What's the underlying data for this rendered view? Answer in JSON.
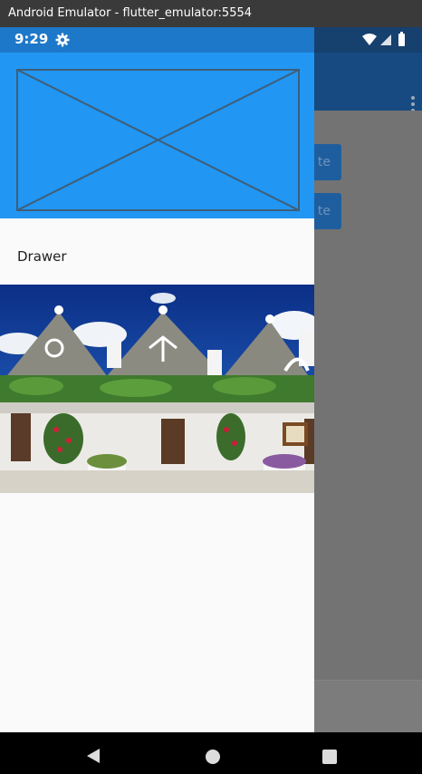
{
  "window": {
    "title": "Android Emulator - flutter_emulator:5554"
  },
  "status_bar": {
    "time": "9:29",
    "settings_icon": "gear-icon",
    "wifi_icon": "wifi-icon",
    "signal_icon": "cell-signal-icon",
    "battery_icon": "battery-icon"
  },
  "background_app": {
    "overflow_menu_icon": "more-vert-icon",
    "buttons": [
      {
        "label": "te"
      },
      {
        "label": "te"
      }
    ]
  },
  "drawer": {
    "header_image": "image-placeholder",
    "title": "Drawer",
    "photo": "trulli-houses-photo"
  },
  "navigation": {
    "back_icon": "back-icon",
    "home_icon": "home-icon",
    "recents_icon": "recents-icon"
  },
  "colors": {
    "drawer_header": "#2196f3",
    "status_bar": "#1e78c9",
    "app_bar": "#174a80",
    "scrim": "#737373"
  }
}
